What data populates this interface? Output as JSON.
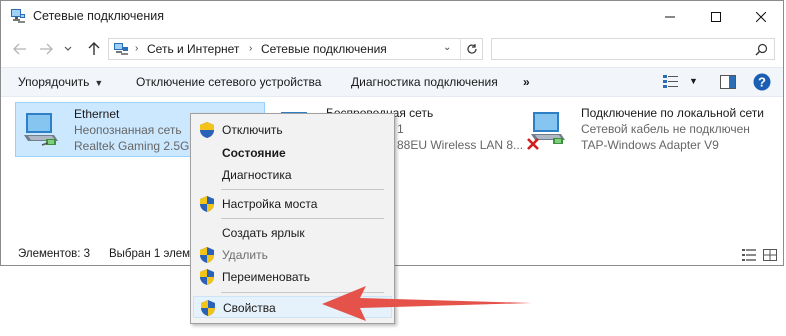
{
  "window": {
    "title": "Сетевые подключения"
  },
  "address": {
    "segments": [
      "Сеть и Интернет",
      "Сетевые подключения"
    ],
    "search_placeholder": ""
  },
  "commands": {
    "organize": "Упорядочить",
    "disable_device": "Отключение сетевого устройства",
    "diagnose": "Диагностика подключения",
    "more": "»"
  },
  "connections": [
    {
      "name": "Ethernet",
      "status": "Неопознанная сеть",
      "adapter": "Realtek Gaming 2.5Gb",
      "selected": true
    },
    {
      "name": "Беспроводная сеть",
      "status": "1",
      "adapter": "88EU Wireless LAN 8...",
      "selected": false
    },
    {
      "name": "Подключение по локальной сети",
      "status": "Сетевой кабель не подключен",
      "adapter": "TAP-Windows Adapter V9",
      "selected": false,
      "disconnected": true
    }
  ],
  "statusbar": {
    "items_count": "Элементов: 3",
    "selected": "Выбран 1 элем"
  },
  "context_menu": {
    "items": [
      {
        "label": "Отключить",
        "shield": true,
        "bold": false,
        "disabled": false
      },
      {
        "label": "Состояние",
        "shield": false,
        "bold": true,
        "disabled": false
      },
      {
        "label": "Диагностика",
        "shield": false,
        "bold": false,
        "disabled": false
      },
      {
        "label": "Настройка моста",
        "shield": true,
        "bold": false,
        "disabled": false
      },
      {
        "label": "Создать ярлык",
        "shield": false,
        "bold": false,
        "disabled": false
      },
      {
        "label": "Удалить",
        "shield": true,
        "bold": false,
        "disabled": true
      },
      {
        "label": "Переименовать",
        "shield": true,
        "bold": false,
        "disabled": false
      },
      {
        "label": "Свойства",
        "shield": true,
        "bold": false,
        "disabled": false,
        "highlighted": true
      }
    ]
  },
  "colors": {
    "selection_bg": "#cce8ff",
    "annotation_arrow": "#e5524a",
    "help_blue": "#1a5fb4"
  },
  "icons": [
    "network-connections-icon",
    "back-arrow-icon",
    "forward-arrow-icon",
    "recent-dropdown-icon",
    "up-arrow-icon",
    "refresh-icon",
    "search-icon",
    "view-options-icon",
    "preview-pane-icon",
    "help-icon",
    "network-adapter-icon",
    "shield-icon",
    "red-x-icon",
    "details-view-icon",
    "large-icons-view-icon"
  ]
}
